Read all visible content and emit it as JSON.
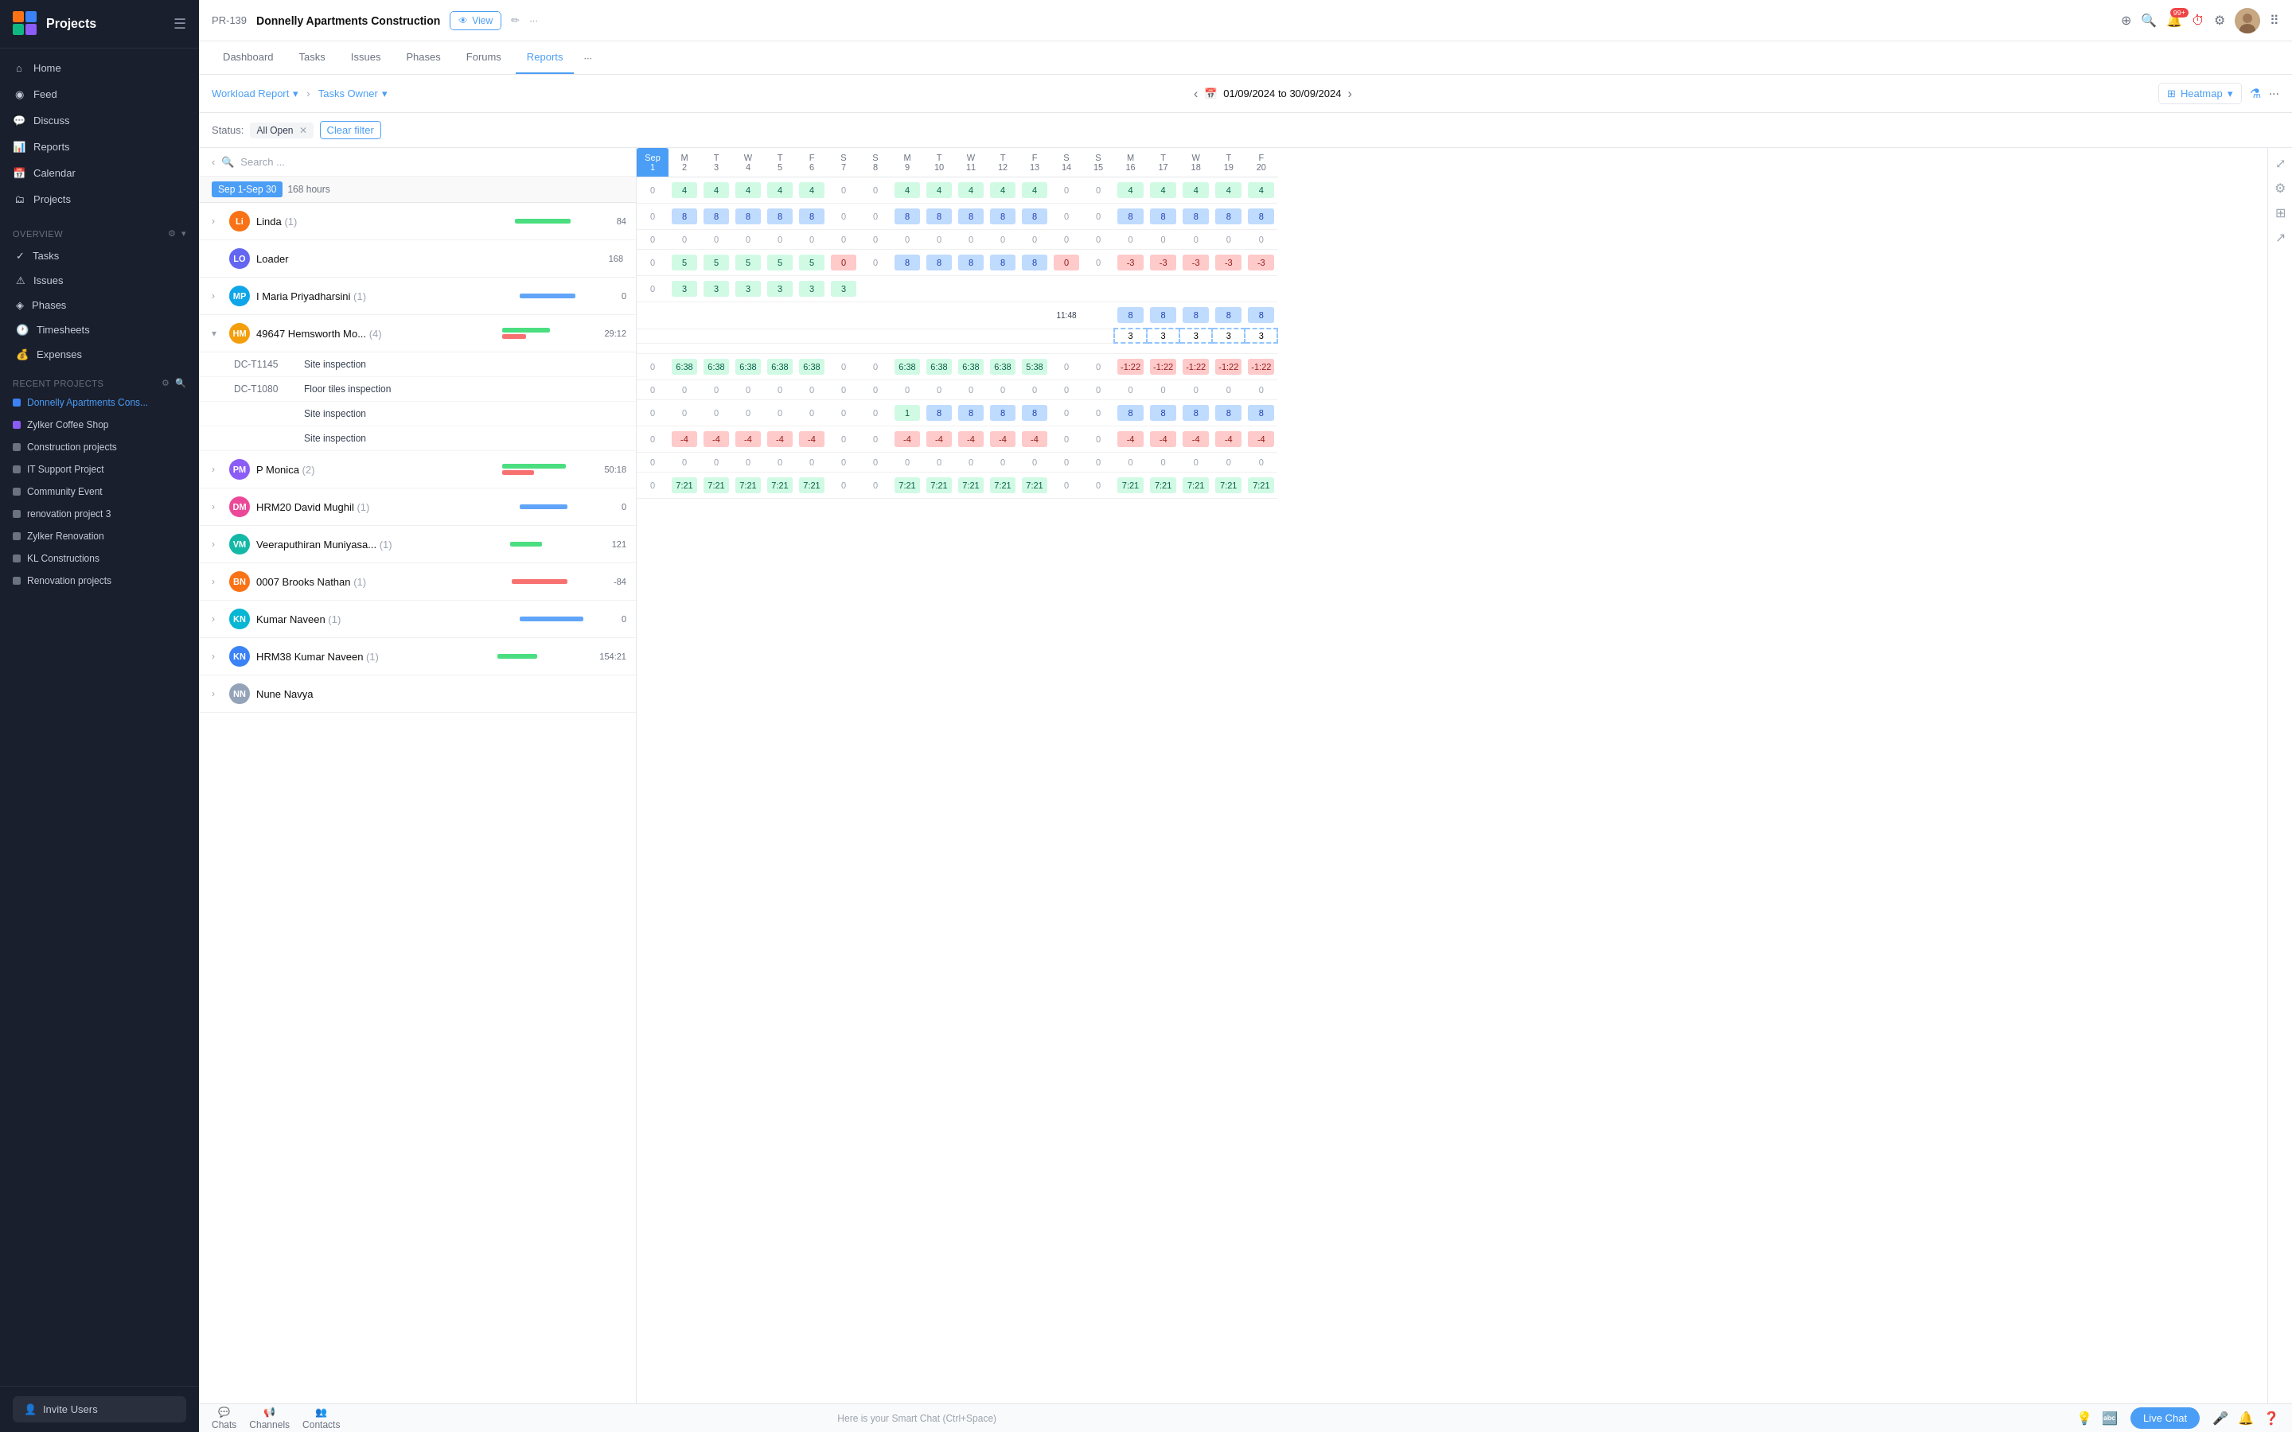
{
  "app": {
    "title": "Projects",
    "hamburger_icon": "☰"
  },
  "sidebar": {
    "nav_items": [
      {
        "id": "home",
        "label": "Home",
        "icon": "⌂"
      },
      {
        "id": "feed",
        "label": "Feed",
        "icon": "◉"
      },
      {
        "id": "discuss",
        "label": "Discuss",
        "icon": "💬"
      },
      {
        "id": "reports",
        "label": "Reports",
        "icon": "📊"
      },
      {
        "id": "calendar",
        "label": "Calendar",
        "icon": "📅"
      },
      {
        "id": "projects",
        "label": "Projects",
        "icon": "🗂"
      }
    ],
    "overview_label": "Overview",
    "sub_nav": [
      {
        "id": "tasks",
        "label": "Tasks"
      },
      {
        "id": "issues",
        "label": "Issues"
      },
      {
        "id": "phases",
        "label": "Phases"
      },
      {
        "id": "timesheets",
        "label": "Timesheets"
      },
      {
        "id": "expenses",
        "label": "Expenses"
      }
    ],
    "recent_label": "Recent Projects",
    "recent_projects": [
      {
        "id": "donnelly",
        "label": "Donnelly Apartments Cons...",
        "color": "#3b82f6",
        "active": true
      },
      {
        "id": "zylker-coffee",
        "label": "Zylker Coffee Shop",
        "color": "#8b5cf6"
      },
      {
        "id": "construction",
        "label": "Construction projects",
        "color": "#6b7280"
      },
      {
        "id": "it-support",
        "label": "IT Support Project",
        "color": "#6b7280"
      },
      {
        "id": "community",
        "label": "Community Event",
        "color": "#6b7280"
      },
      {
        "id": "renovation3",
        "label": "renovation project 3",
        "color": "#6b7280"
      },
      {
        "id": "zylker-reno",
        "label": "Zylker Renovation",
        "color": "#6b7280"
      },
      {
        "id": "kl-const",
        "label": "KL Constructions",
        "color": "#6b7280"
      },
      {
        "id": "reno-proj",
        "label": "Renovation projects",
        "color": "#6b7280"
      }
    ],
    "invite_label": "Invite Users"
  },
  "topbar": {
    "project_id": "PR-139",
    "project_name": "Donnelly Apartments Construction",
    "view_label": "View",
    "badge_count": "99+",
    "tabs": [
      {
        "id": "dashboard",
        "label": "Dashboard"
      },
      {
        "id": "tasks",
        "label": "Tasks"
      },
      {
        "id": "issues",
        "label": "Issues"
      },
      {
        "id": "phases",
        "label": "Phases"
      },
      {
        "id": "forums",
        "label": "Forums"
      },
      {
        "id": "reports",
        "label": "Reports",
        "active": true
      }
    ]
  },
  "report_header": {
    "workload_label": "Workload Report",
    "tasks_owner_label": "Tasks Owner",
    "date_range": "01/09/2024 to 30/09/2024",
    "heatmap_label": "Heatmap"
  },
  "status_filter": {
    "label": "Status:",
    "value": "All Open",
    "clear_label": "Clear filter"
  },
  "summary": {
    "period_label": "Sep 1-Sep 30",
    "hours_label": "168 hours"
  },
  "resources": [
    {
      "id": "linda",
      "name": "Linda",
      "count": 1,
      "bar_green": 70,
      "bar_blue": 0,
      "bar_red": 0,
      "hours": "84",
      "avatar_color": "#f97316",
      "avatar_text": "Li"
    },
    {
      "id": "loader",
      "name": "Loader",
      "count": 0,
      "bar_green": 0,
      "bar_blue": 0,
      "bar_red": 0,
      "hours": "168",
      "avatar_color": "#6366f1",
      "avatar_text": "LO",
      "is_loader": true
    },
    {
      "id": "maria",
      "name": "I Maria Priyadharsini",
      "count": 1,
      "bar_green": 0,
      "bar_blue": 70,
      "bar_red": 0,
      "hours": "0",
      "avatar_color": "#0ea5e9",
      "avatar_text": "MP"
    },
    {
      "id": "hemsworth",
      "name": "49647 Hemsworth Mo...",
      "count": 4,
      "bar_green": 60,
      "bar_blue": 0,
      "bar_red": 30,
      "hours": "29:12",
      "avatar_color": "#f59e0b",
      "avatar_text": "HM",
      "expanded": true,
      "subtasks": [
        {
          "id": "DC-T1145",
          "name": "Site inspection"
        },
        {
          "id": "DC-T1080",
          "name": "Floor tiles inspection"
        },
        {
          "id": "",
          "name": "Site inspection"
        },
        {
          "id": "",
          "name": "Site inspection"
        }
      ]
    },
    {
      "id": "monica",
      "name": "P Monica",
      "count": 2,
      "bar_green": 80,
      "bar_blue": 0,
      "bar_red": 40,
      "hours": "50:18",
      "avatar_color": "#8b5cf6",
      "avatar_text": "PM"
    },
    {
      "id": "mughil",
      "name": "HRM20 David Mughil",
      "count": 1,
      "bar_green": 0,
      "bar_blue": 60,
      "bar_red": 0,
      "hours": "0",
      "avatar_color": "#ec4899",
      "avatar_text": "DM"
    },
    {
      "id": "muniyasa",
      "name": "Veeraputhiran Muniyasa...",
      "count": 1,
      "bar_green": 40,
      "bar_blue": 0,
      "bar_red": 0,
      "hours": "121",
      "avatar_color": "#14b8a6",
      "avatar_text": "VM"
    },
    {
      "id": "brooks",
      "name": "0007 Brooks Nathan",
      "count": 1,
      "bar_green": 0,
      "bar_blue": 0,
      "bar_red": 70,
      "hours": "-84",
      "avatar_color": "#f97316",
      "avatar_text": "BN"
    },
    {
      "id": "naveen",
      "name": "Kumar Naveen",
      "count": 1,
      "bar_green": 0,
      "bar_blue": 80,
      "bar_red": 0,
      "hours": "0",
      "avatar_color": "#06b6d4",
      "avatar_text": "KN"
    },
    {
      "id": "naveen2",
      "name": "HRM38 Kumar Naveen",
      "count": 1,
      "bar_green": 50,
      "bar_blue": 0,
      "bar_red": 0,
      "hours": "154:21",
      "avatar_color": "#3b82f6",
      "avatar_text": "KN"
    },
    {
      "id": "nune",
      "name": "Nune Navya",
      "count": 0,
      "bar_green": 0,
      "bar_blue": 0,
      "bar_red": 0,
      "hours": "",
      "avatar_color": "#94a3b8",
      "avatar_text": "NN"
    }
  ],
  "calendar": {
    "col_headers": [
      {
        "day": "Sep",
        "date": "1",
        "highlight": true
      },
      {
        "day": "M",
        "date": "2"
      },
      {
        "day": "T",
        "date": "3"
      },
      {
        "day": "W",
        "date": "4"
      },
      {
        "day": "T",
        "date": "5"
      },
      {
        "day": "F",
        "date": "6"
      },
      {
        "day": "S",
        "date": "7"
      },
      {
        "day": "S",
        "date": "8"
      },
      {
        "day": "M",
        "date": "9"
      },
      {
        "day": "T",
        "date": "10"
      },
      {
        "day": "W",
        "date": "11"
      },
      {
        "day": "T",
        "date": "12"
      },
      {
        "day": "F",
        "date": "13"
      },
      {
        "day": "S",
        "date": "14"
      },
      {
        "day": "S",
        "date": "15"
      },
      {
        "day": "M",
        "date": "16"
      },
      {
        "day": "T",
        "date": "17"
      },
      {
        "day": "W",
        "date": "18"
      },
      {
        "day": "T",
        "date": "19"
      },
      {
        "day": "F",
        "date": "20"
      }
    ]
  },
  "bottom_bar": {
    "chat_placeholder": "Here is your Smart Chat (Ctrl+Space)",
    "chats_label": "Chats",
    "channels_label": "Channels",
    "contacts_label": "Contacts",
    "live_chat_label": "Live Chat"
  }
}
